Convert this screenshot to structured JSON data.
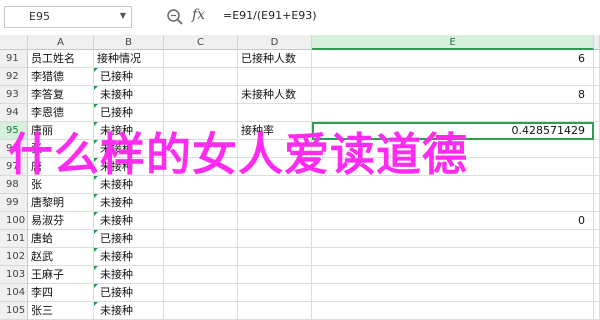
{
  "name_box": {
    "value": "E95"
  },
  "formula": {
    "text": "=E91/(E91+E93)"
  },
  "icons": {
    "zoom": "zoom-icon",
    "fx": "fx-icon",
    "dropdown": "chevron-down-icon"
  },
  "columns": [
    "A",
    "B",
    "C",
    "D",
    "E"
  ],
  "selected_column": "E",
  "selected_row": "95",
  "accent_color": "#2a9f52",
  "overlay_color": "#ff2bf1",
  "rows": [
    {
      "num": "91",
      "a": "员工姓名",
      "b": "接种情况",
      "c": "",
      "d": "已接种人数",
      "e": "6"
    },
    {
      "num": "92",
      "a": "李猎德",
      "b": "已接种",
      "c": "",
      "d": "",
      "e": ""
    },
    {
      "num": "93",
      "a": "李答复",
      "b": "未接种",
      "c": "",
      "d": "未接种人数",
      "e": "8"
    },
    {
      "num": "94",
      "a": "李恩德",
      "b": "已接种",
      "c": "",
      "d": "",
      "e": ""
    },
    {
      "num": "95",
      "a": "唐丽",
      "b": "未接种",
      "c": "",
      "d": "接种率",
      "e": "0.428571429"
    },
    {
      "num": "96",
      "a": "张",
      "b": "未接种",
      "c": "",
      "d": "",
      "e": ""
    },
    {
      "num": "97",
      "a": "唐",
      "b": "未接种",
      "c": "",
      "d": "",
      "e": ""
    },
    {
      "num": "98",
      "a": "张",
      "b": "未接种",
      "c": "",
      "d": "",
      "e": ""
    },
    {
      "num": "99",
      "a": "唐黎明",
      "b": "未接种",
      "c": "",
      "d": "",
      "e": ""
    },
    {
      "num": "100",
      "a": "易淑芬",
      "b": "未接种",
      "c": "",
      "d": "",
      "e": "0"
    },
    {
      "num": "101",
      "a": "唐蛤",
      "b": "已接种",
      "c": "",
      "d": "",
      "e": ""
    },
    {
      "num": "102",
      "a": "赵武",
      "b": "未接种",
      "c": "",
      "d": "",
      "e": ""
    },
    {
      "num": "103",
      "a": "王麻子",
      "b": "未接种",
      "c": "",
      "d": "",
      "e": ""
    },
    {
      "num": "104",
      "a": "李四",
      "b": "已接种",
      "c": "",
      "d": "",
      "e": ""
    },
    {
      "num": "105",
      "a": "张三",
      "b": "未接种",
      "c": "",
      "d": "",
      "e": ""
    }
  ],
  "overlay_text": "什么样的女人爱读道德"
}
